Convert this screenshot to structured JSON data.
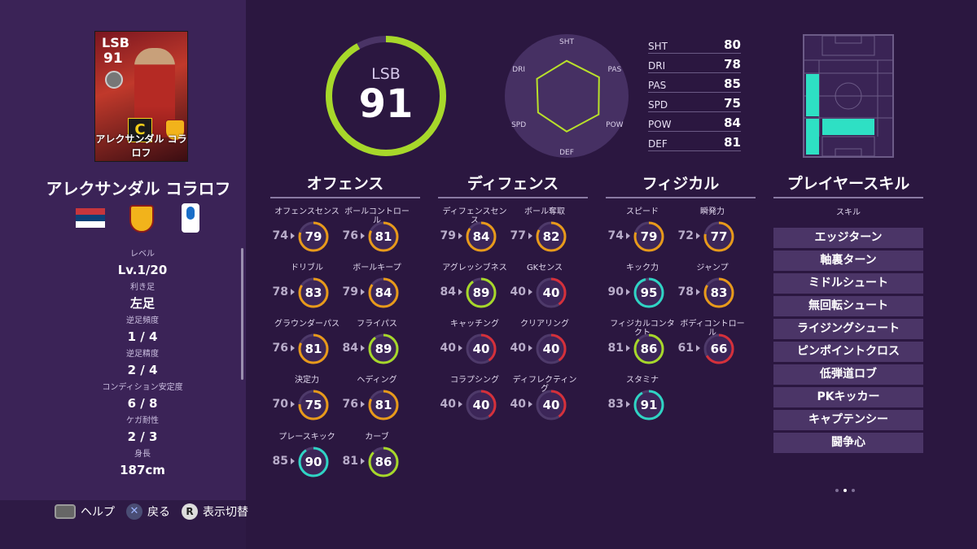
{
  "card": {
    "position": "LSB",
    "rating": "91",
    "grade": "C",
    "name": "アレクサンダル コラロフ"
  },
  "player_name": "アレクサンダル コラロフ",
  "info": [
    {
      "label": "レベル",
      "value": "Lv.1/20"
    },
    {
      "label": "利き足",
      "value": "左足"
    },
    {
      "label": "逆足頻度",
      "value": "1 / 4"
    },
    {
      "label": "逆足精度",
      "value": "2 / 4"
    },
    {
      "label": "コンディション安定度",
      "value": "6 / 8"
    },
    {
      "label": "ケガ耐性",
      "value": "2 / 3"
    },
    {
      "label": "身長",
      "value": "187cm"
    }
  ],
  "help": {
    "help": "ヘルプ",
    "back": "戻る",
    "toggle": "表示切替",
    "x_icon": "✕",
    "r_icon": "R"
  },
  "overall": {
    "position": "LSB",
    "value": "91",
    "color": "#a7d82a"
  },
  "radar": {
    "labels": [
      "SHT",
      "PAS",
      "POW",
      "DEF",
      "SPD",
      "DRI"
    ],
    "color": "#b9e12a"
  },
  "summary": [
    {
      "key": "SHT",
      "value": "80"
    },
    {
      "key": "DRI",
      "value": "78"
    },
    {
      "key": "PAS",
      "value": "85"
    },
    {
      "key": "SPD",
      "value": "75"
    },
    {
      "key": "POW",
      "value": "84"
    },
    {
      "key": "DEF",
      "value": "81"
    }
  ],
  "columns": {
    "offense": "オフェンス",
    "defense": "ディフェンス",
    "physical": "フィジカル",
    "skills": "プレイヤースキル"
  },
  "offense": [
    {
      "name": "オフェンスセンス",
      "base": "74",
      "value": "79"
    },
    {
      "name": "ボールコントロール",
      "base": "76",
      "value": "81"
    },
    {
      "name": "ドリブル",
      "base": "78",
      "value": "83"
    },
    {
      "name": "ボールキープ",
      "base": "79",
      "value": "84"
    },
    {
      "name": "グラウンダーパス",
      "base": "76",
      "value": "81"
    },
    {
      "name": "フライパス",
      "base": "84",
      "value": "89"
    },
    {
      "name": "決定力",
      "base": "70",
      "value": "75"
    },
    {
      "name": "ヘディング",
      "base": "76",
      "value": "81"
    },
    {
      "name": "プレースキック",
      "base": "85",
      "value": "90"
    },
    {
      "name": "カーブ",
      "base": "81",
      "value": "86"
    }
  ],
  "defense": [
    {
      "name": "ディフェンスセンス",
      "base": "79",
      "value": "84"
    },
    {
      "name": "ボール奪取",
      "base": "77",
      "value": "82"
    },
    {
      "name": "アグレッシブネス",
      "base": "84",
      "value": "89"
    },
    {
      "name": "GKセンス",
      "base": "40",
      "value": "40"
    },
    {
      "name": "キャッチング",
      "base": "40",
      "value": "40"
    },
    {
      "name": "クリアリング",
      "base": "40",
      "value": "40"
    },
    {
      "name": "コラプシング",
      "base": "40",
      "value": "40"
    },
    {
      "name": "ディフレクティング",
      "base": "40",
      "value": "40"
    }
  ],
  "physical": [
    {
      "name": "スピード",
      "base": "74",
      "value": "79"
    },
    {
      "name": "瞬発力",
      "base": "72",
      "value": "77"
    },
    {
      "name": "キック力",
      "base": "90",
      "value": "95"
    },
    {
      "name": "ジャンプ",
      "base": "78",
      "value": "83"
    },
    {
      "name": "フィジカルコンタクト",
      "base": "81",
      "value": "86"
    },
    {
      "name": "ボディコントロール",
      "base": "61",
      "value": "66"
    },
    {
      "name": "スタミナ",
      "base": "83",
      "value": "91"
    }
  ],
  "skills_sub": "スキル",
  "skills": [
    "エッジターン",
    "軸裏ターン",
    "ミドルシュート",
    "無回転シュート",
    "ライジングシュート",
    "ピンポイントクロス",
    "低弾道ロブ",
    "PKキッカー",
    "キャプテンシー",
    "闘争心"
  ],
  "colors": {
    "green": "#a7d82a",
    "orange": "#e89a1a",
    "red": "#d6303a",
    "teal": "#2fd4c4",
    "pitch_fill": "#2ee0c4"
  }
}
